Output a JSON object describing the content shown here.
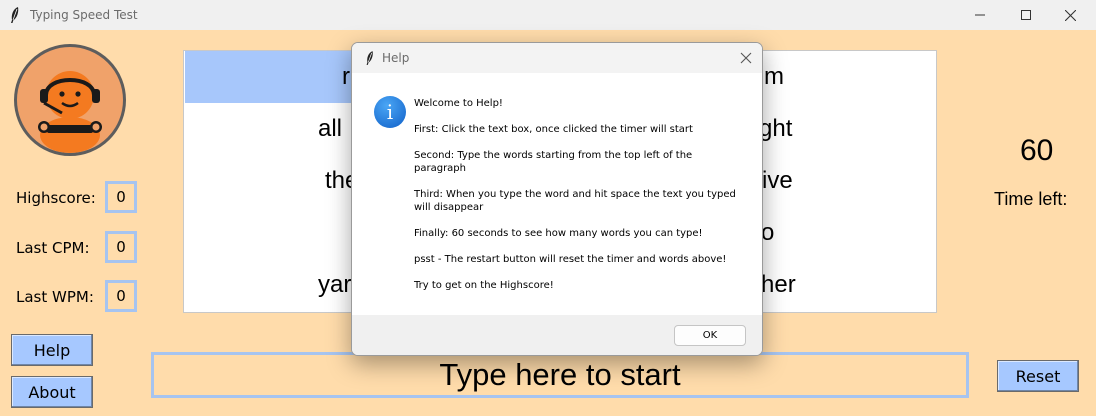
{
  "window": {
    "title": "Typing Speed Test",
    "icon": "feather-icon"
  },
  "stats": {
    "highscore_label": "Highscore:",
    "highscore_value": "0",
    "last_cpm_label": "Last CPM:",
    "last_cpm_value": "0",
    "last_wpm_label": "Last WPM:",
    "last_wpm_value": "0"
  },
  "buttons": {
    "help": "Help",
    "about": "About",
    "reset": "Reset"
  },
  "words": {
    "row1": [
      "r",
      "m"
    ],
    "row2": [
      "all",
      "ght"
    ],
    "row3": [
      "the",
      "ive"
    ],
    "row4": [
      "o"
    ],
    "row5": [
      "yar",
      "her"
    ]
  },
  "timer": {
    "value": "60",
    "label": "Time left:"
  },
  "entry": {
    "text": "Type here to start"
  },
  "dialog": {
    "title": "Help",
    "icon": "info-icon",
    "lines": [
      "Welcome to Help!",
      "First: Click the text box, once clicked the timer will start",
      "Second: Type the words starting from the top left of the paragraph",
      "Third: When you type the word and hit space the text you typed will disappear",
      "Finally: 60 seconds to see how many words you can type!",
      "psst - The restart button will reset the timer and words above!",
      "Try to get on the Highscore!"
    ],
    "ok_label": "OK"
  },
  "colors": {
    "background": "#ffdcab",
    "button": "#a6c8ff",
    "highlight": "#a7c7fb",
    "border": "#a6c4f0"
  }
}
